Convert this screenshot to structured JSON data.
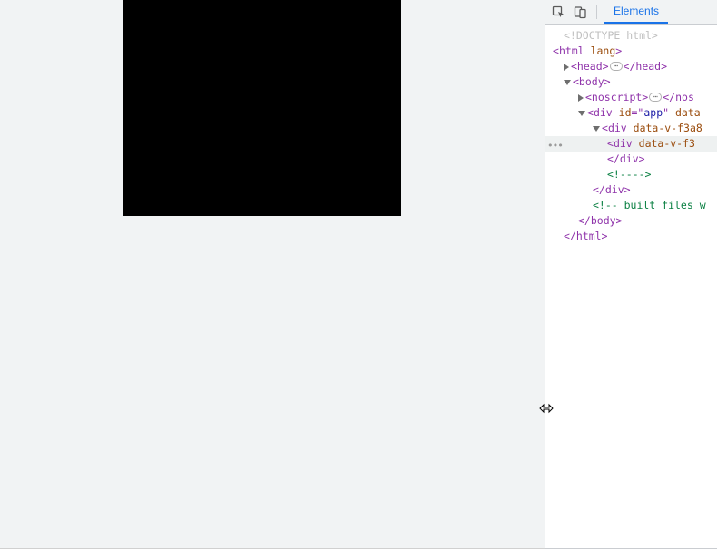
{
  "toolbar": {
    "tabs": {
      "elements": "Elements"
    }
  },
  "dom": {
    "doctype": "<!DOCTYPE html>",
    "html_open_pre": "<",
    "html_tag": "html",
    "html_attr": " lang",
    "html_open_post": ">",
    "head_open": "<head>",
    "head_close": "</head>",
    "body_open": "<body>",
    "noscript_open": "<noscript>",
    "noscript_close": "</nos",
    "div_app_open_pre": "<",
    "div_app_tag": "div",
    "div_app_attrs_id_name": " id",
    "div_app_attrs_id_eq": "=\"",
    "div_app_attrs_id_val": "app",
    "div_app_attrs_id_q": "\"",
    "div_app_attrs_rest": " data",
    "div_v1_pre": "<",
    "div_v1_tag": "div",
    "div_v1_attr_name": " data-v-f3a8",
    "div_v2_pre": "<",
    "div_v2_tag": "div",
    "div_v2_attr_name": " data-v-f3",
    "div_close1": "</div>",
    "comment_empty": "<!---->",
    "div_close2": "</div>",
    "comment_built": "<!-- built files w",
    "body_close": "</body>",
    "html_close": "</html>"
  },
  "gutter": {
    "dots": "•••"
  }
}
